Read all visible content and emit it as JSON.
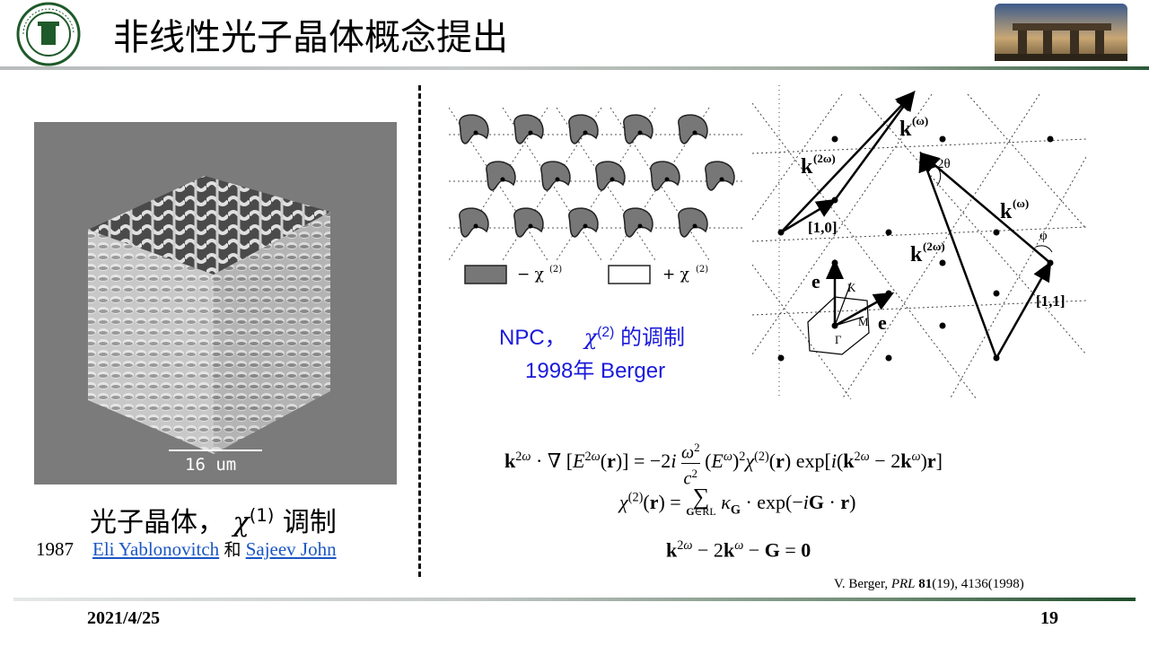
{
  "header": {
    "title": "非线性光子晶体概念提出",
    "logo_icon": "university-seal-icon",
    "photo_icon": "campus-gate-photo-icon"
  },
  "left_panel": {
    "scale_bar": "16 um",
    "caption_text": "光子晶体，",
    "caption_symbol": "χ",
    "caption_sup": "(1)",
    "caption_suffix": " 调制",
    "year": "1987",
    "person1": "Eli Yablonovitch",
    "conj": "和",
    "person2": "Sajeev John"
  },
  "npc_panel": {
    "legend_minus": "− χ",
    "legend_plus": "+ χ",
    "legend_sup": "(2)",
    "caption_prefix": "NPC，",
    "caption_symbol": "χ",
    "caption_sup": "(2)",
    "caption_suffix": " 的调制",
    "year_line": "1998年 Berger"
  },
  "diagram": {
    "label_k_omega_top": "k",
    "label_k_2omega_top": "k",
    "label_k_omega_mid": "k",
    "label_k_2omega_mid": "k",
    "sup_omega": "(ω)",
    "sup_2omega": "(2ω)",
    "label_10": "[1,0]",
    "label_11": "[1,1]",
    "label_2theta": "2θ",
    "label_phi": "φ",
    "label_e2": "e",
    "label_e1": "e",
    "label_K": "K",
    "label_M": "M",
    "label_Gamma": "Γ"
  },
  "footer": {
    "reference_author": "V. Berger,",
    "reference_journal": "PRL",
    "reference_volume": "81",
    "reference_rest": "(19), 4136(1998)",
    "date": "2021/4/25",
    "page": "19"
  },
  "colors": {
    "npc_caption": "#1a1adc",
    "link": "#1a56c4",
    "rule_green": "#1f4d2c"
  }
}
